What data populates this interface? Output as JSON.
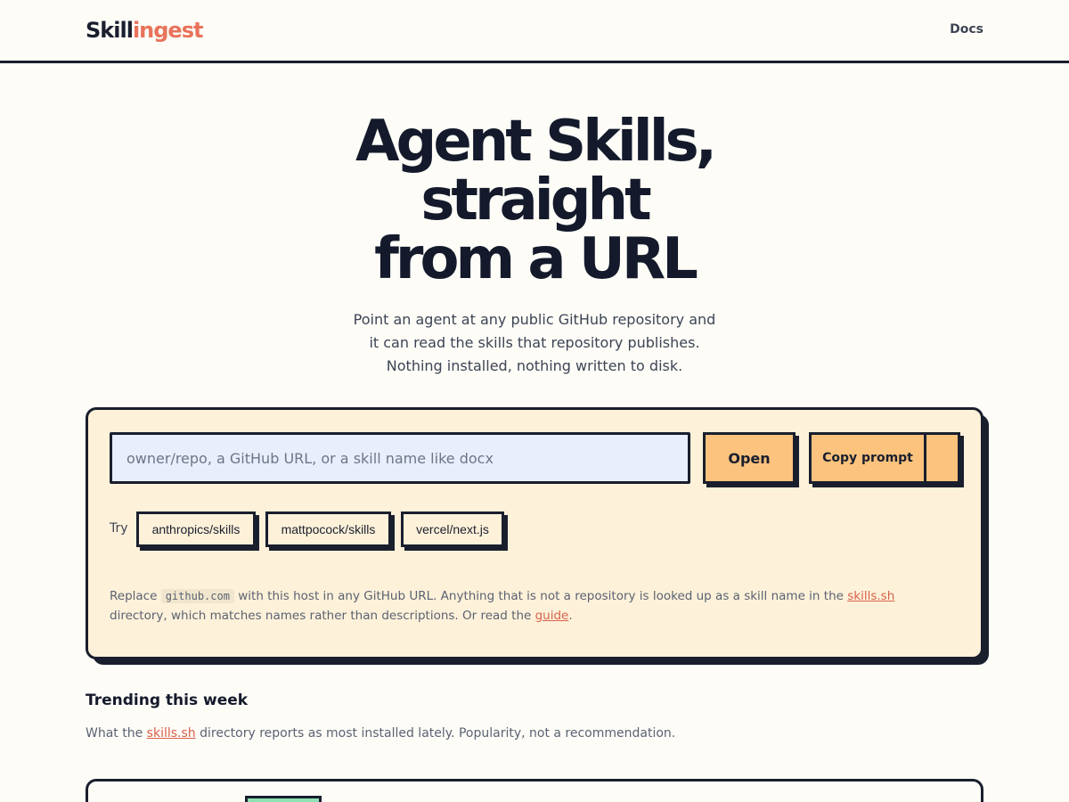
{
  "header": {
    "logo_part1": "Skill",
    "logo_part2": "ingest",
    "docs_link": "Docs"
  },
  "hero": {
    "title_line1": "Agent Skills,",
    "title_line2": "straight",
    "title_line3": "from a URL",
    "subtitle": "Point an agent at any public GitHub repository and it can read the skills that repository publishes. Nothing installed, nothing written to disk."
  },
  "search": {
    "placeholder": "owner/repo, a GitHub URL, or a skill name like docx",
    "value": "",
    "open_label": "Open",
    "copy_label": "Copy prompt"
  },
  "try": {
    "label": "Try",
    "chips": [
      "anthropics/skills",
      "mattpocock/skills",
      "vercel/next.js"
    ]
  },
  "note": {
    "text1": "Replace ",
    "code": "github.com",
    "text2": " with this host in any GitHub URL. Anything that is not a repository is looked up as a skill name in the ",
    "link1": "skills.sh",
    "text3": " directory, which matches names rather than descriptions. Or read the ",
    "link2": "guide",
    "text4": "."
  },
  "trending": {
    "heading": "Trending this week",
    "sub_text1": "What the ",
    "sub_link": "skills.sh",
    "sub_text2": " directory reports as most installed lately. Popularity, not a recommendation."
  },
  "colors": {
    "accent": "#e8735a",
    "button": "#fbc37d",
    "panel": "#fdf1d9",
    "input": "#e8eefb",
    "badge": "#8fe0b2"
  }
}
